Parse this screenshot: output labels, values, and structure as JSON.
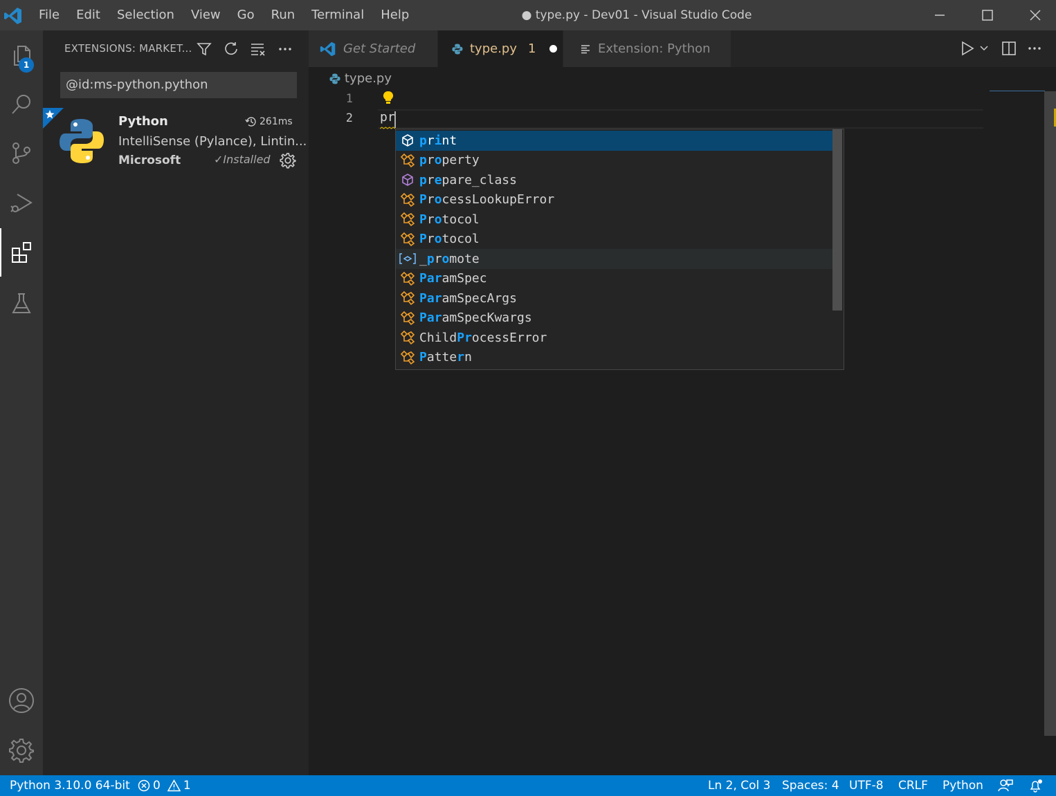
{
  "titlebar": {
    "menus": [
      "File",
      "Edit",
      "Selection",
      "View",
      "Go",
      "Run",
      "Terminal",
      "Help"
    ],
    "window_title": "● type.py - Dev01 - Visual Studio Code"
  },
  "activity_bar": {
    "explorer_badge": "1",
    "items": [
      "explorer",
      "search",
      "source-control",
      "run-and-debug",
      "extensions",
      "testing",
      "accounts",
      "manage"
    ]
  },
  "sidebar": {
    "title": "EXTENSIONS: MARKET...",
    "search_value": "@id:ms-python.python",
    "extension": {
      "name": "Python",
      "time": "261ms",
      "description": "IntelliSense (Pylance), Lintin...",
      "publisher": "Microsoft",
      "status": "Installed"
    }
  },
  "tabs": [
    {
      "label": "Get Started",
      "icon": "vscode-icon"
    },
    {
      "label": "type.py",
      "problems": "1",
      "icon": "python-icon",
      "modified": true
    },
    {
      "label": "Extension: Python",
      "icon": "preview-icon"
    }
  ],
  "editor": {
    "breadcrumb": "type.py",
    "line_numbers": [
      "1",
      "2"
    ],
    "code_line2": "pr"
  },
  "suggestions": [
    {
      "text": "print",
      "kind": "function",
      "match": [
        0,
        2
      ]
    },
    {
      "text": "property",
      "kind": "class",
      "match": [
        0,
        2
      ]
    },
    {
      "text": "prepare_class",
      "kind": "function-purple",
      "match": [
        0,
        2
      ]
    },
    {
      "text": "ProcessLookupError",
      "kind": "class",
      "match": [
        0,
        2
      ]
    },
    {
      "text": "Protocol",
      "kind": "class",
      "match": [
        0,
        2
      ]
    },
    {
      "text": "Protocol",
      "kind": "class",
      "match": [
        0,
        2
      ]
    },
    {
      "text": "_promote",
      "kind": "variable",
      "match": [
        1,
        3
      ]
    },
    {
      "text": "ParamSpec",
      "kind": "class",
      "match": [
        0,
        1,
        2
      ]
    },
    {
      "text": "ParamSpecArgs",
      "kind": "class",
      "match": [
        0,
        1,
        2
      ]
    },
    {
      "text": "ParamSpecKwargs",
      "kind": "class",
      "match": [
        0,
        1,
        2
      ]
    },
    {
      "text": "ChildProcessError",
      "kind": "class",
      "match": [
        5,
        6
      ]
    },
    {
      "text": "Pattern",
      "kind": "class",
      "match": [
        0,
        5
      ]
    }
  ],
  "statusbar": {
    "interpreter": "Python 3.10.0 64-bit",
    "errors": "0",
    "warnings": "1",
    "position": "Ln 2, Col 3",
    "spaces": "Spaces: 4",
    "encoding": "UTF-8",
    "eol": "CRLF",
    "language": "Python"
  },
  "colors": {
    "accent": "#007acc",
    "selection": "#094771",
    "match_highlight": "#18a3ff",
    "class_icon": "#ee9d28",
    "function_icon_purple": "#b180d7",
    "modified_tab": "#e2c08d"
  }
}
